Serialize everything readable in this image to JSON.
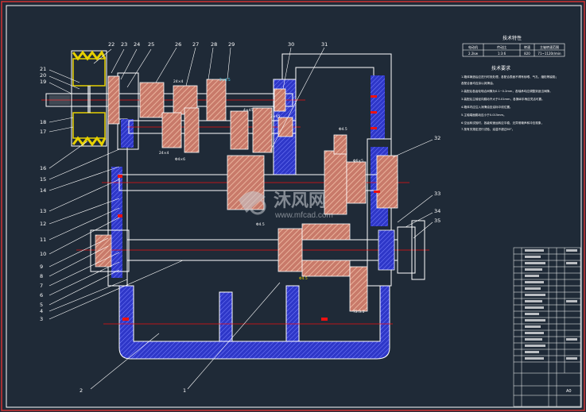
{
  "drawing": {
    "part_numbers_left": [
      "21",
      "20",
      "19",
      "18",
      "17",
      "16",
      "15",
      "14",
      "13",
      "12",
      "11",
      "10",
      "9",
      "8",
      "7",
      "6",
      "5",
      "4",
      "3"
    ],
    "part_numbers_top": [
      "22",
      "23",
      "24",
      "25",
      "26",
      "27",
      "28",
      "29",
      "30",
      "31"
    ],
    "part_numbers_right": [
      "32",
      "33",
      "34",
      "35"
    ],
    "part_numbers_bottom": [
      "2",
      "1"
    ],
    "dimension_labels": [
      "24×4",
      "2×4.5",
      "24×4",
      "Φ4×6",
      "4×45",
      "3×45",
      "Φ4.5",
      "Φ6×5",
      "72.3.5",
      "Φ4.5",
      "Φ4.5"
    ]
  },
  "spec_table": {
    "title": "技术特性",
    "headers": [
      "电动机",
      "传动比",
      "转速",
      "主轴转速范围"
    ],
    "values": [
      "2.2kw",
      "1:3:6",
      "820",
      "71~1120r/min"
    ]
  },
  "tech_requirements": {
    "title": "技术要求",
    "items": [
      "1.箱体铸造后应进行时效处理，各配合表面不得有砂眼、气孔、缩松等缺陷；",
      "   各配合面均应涂以润滑油。",
      "2.装配后各齿轮啮合间隙为0.1~0.2mm，各轴承均应调整到适当间隙。",
      "3.装配后主轴径向跳动不大于0.01mm，各操纵手柄应灵活可靠。",
      "4.箱体内应注入润滑油至油标中线位置。",
      "5.主轴端面跳动应小于0.015mm。",
      "6.空运转试验时，各级转速运转应平稳，无异常噪声和冲击现象，",
      "7.按有关规定进行试验，油温不超过60°。"
    ]
  },
  "watermark": {
    "brand": "沐风网",
    "url": "www.mfcad.com"
  },
  "title_block": {
    "scale_label": "A0"
  },
  "colors": {
    "background": "#1f2a37",
    "outline": "#ffffff",
    "section_hatch": "#3a3fd8",
    "shaft_center": "#e11",
    "gear": "#e8a080",
    "pulley": "#e6d000",
    "frame": "#d23232"
  }
}
